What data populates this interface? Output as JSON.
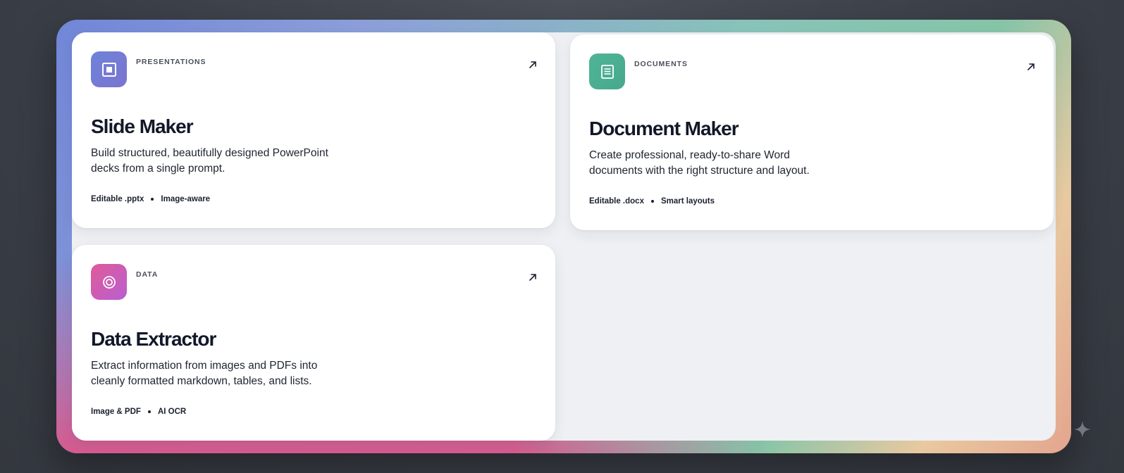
{
  "cards": [
    {
      "category": "PRESENTATIONS",
      "title": "Slide Maker",
      "description": "Build structured, beautifully designed PowerPoint decks from a single prompt.",
      "tags": [
        "Editable .pptx",
        "Image-aware"
      ],
      "icon": "slide-icon",
      "accent": "#6f7fd6"
    },
    {
      "category": "DOCUMENTS",
      "title": "Document Maker",
      "description": "Create professional, ready-to-share Word documents with the right structure and layout.",
      "tags": [
        "Editable .docx",
        "Smart layouts"
      ],
      "icon": "document-icon",
      "accent": "#4caf93"
    },
    {
      "category": "DATA",
      "title": "Data Extractor",
      "description": "Extract information from images and PDFs into cleanly formatted markdown, tables, and lists.",
      "tags": [
        "Image & PDF",
        "AI OCR"
      ],
      "icon": "target-icon",
      "accent": "#d1559e"
    }
  ]
}
